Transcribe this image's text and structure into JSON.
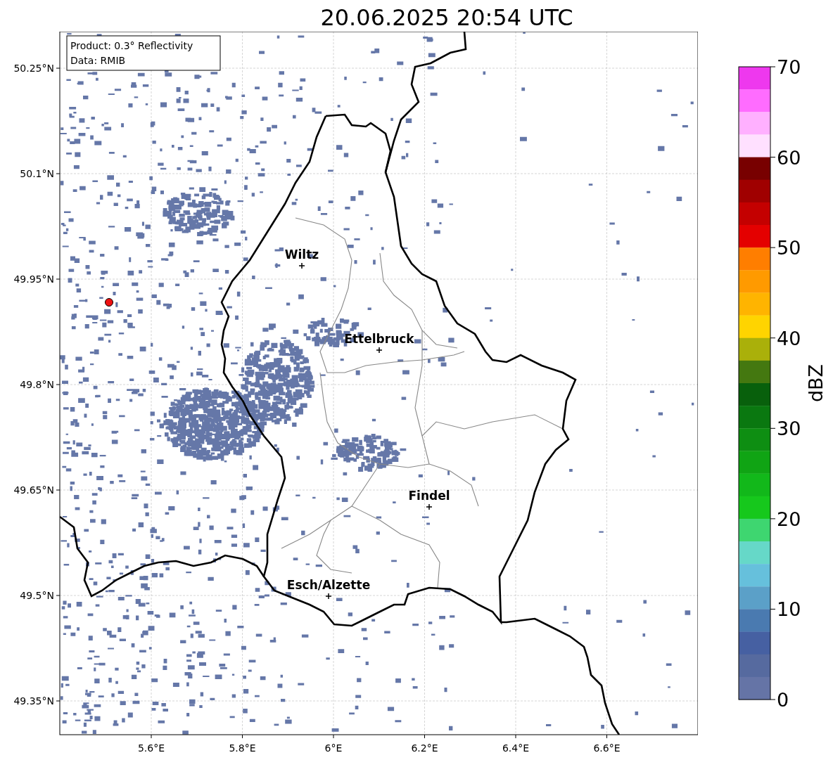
{
  "title": "20.06.2025 20:54 UTC",
  "info_box": [
    "Product: 0.3° Reflectivity",
    "Data: RMIB"
  ],
  "map": {
    "yticks": [
      "50.25°N",
      "50.1°N",
      "49.95°N",
      "49.8°N",
      "49.65°N",
      "49.5°N",
      "49.35°N"
    ],
    "xticks": [
      "5.6°E",
      "5.8°E",
      "6°E",
      "6.2°E",
      "6.4°E",
      "6.6°E"
    ],
    "cities": [
      {
        "name": "Wiltz"
      },
      {
        "name": "Ettelbruck"
      },
      {
        "name": "Findel"
      },
      {
        "name": "Esch/Alzette"
      }
    ]
  },
  "colorbar": {
    "label": "dBZ",
    "ticks": [
      "70",
      "60",
      "50",
      "40",
      "30",
      "20",
      "10",
      "0"
    ],
    "segments": [
      {
        "color": "#ee38ee"
      },
      {
        "color": "#ff6cff"
      },
      {
        "color": "#ffb0ff"
      },
      {
        "color": "#ffe0ff"
      },
      {
        "color": "#780000"
      },
      {
        "color": "#a00000"
      },
      {
        "color": "#c40000"
      },
      {
        "color": "#e40000"
      },
      {
        "color": "#ff7e00"
      },
      {
        "color": "#ff9a00"
      },
      {
        "color": "#ffb400"
      },
      {
        "color": "#ffd400"
      },
      {
        "color": "#aab00a"
      },
      {
        "color": "#447810"
      },
      {
        "color": "#08600c"
      },
      {
        "color": "#0a7810"
      },
      {
        "color": "#0e8e12"
      },
      {
        "color": "#10a414"
      },
      {
        "color": "#12b81a"
      },
      {
        "color": "#16c81c"
      },
      {
        "color": "#3ed670"
      },
      {
        "color": "#66d8c8"
      },
      {
        "color": "#66c0dc"
      },
      {
        "color": "#5ba0c8"
      },
      {
        "color": "#4a7ab0"
      },
      {
        "color": "#4660a2"
      },
      {
        "color": "#566a9f"
      },
      {
        "color": "#6574a6"
      }
    ]
  }
}
